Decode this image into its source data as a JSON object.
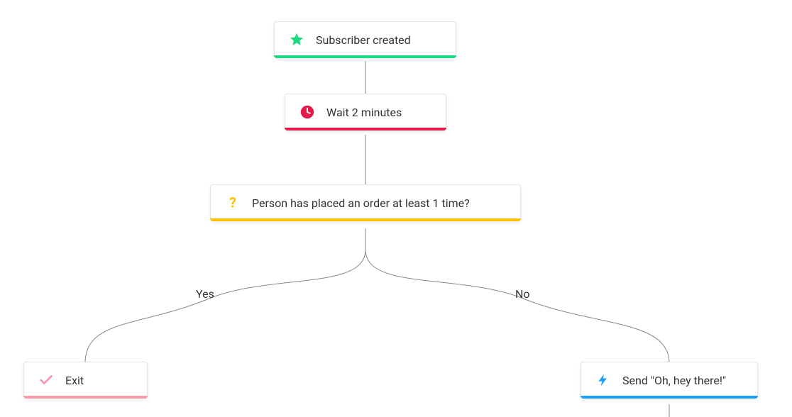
{
  "nodes": {
    "trigger": {
      "label": "Subscriber created",
      "accent_color": "#1ED984"
    },
    "wait": {
      "label": "Wait 2 minutes",
      "accent_color": "#E31B4C",
      "icon_color": "#E31B4C"
    },
    "condition": {
      "label": "Person has placed an order at least 1 time?",
      "accent_color": "#FFC107",
      "icon_color": "#FFC107"
    },
    "exit": {
      "label": "Exit",
      "accent_color": "#F59CAE",
      "icon_color": "#F59CAE"
    },
    "send": {
      "label": "Send \"Oh, hey there!\"",
      "accent_color": "#1DA1F2",
      "icon_color": "#1DA1F2"
    }
  },
  "branches": {
    "yes": "Yes",
    "no": "No"
  }
}
